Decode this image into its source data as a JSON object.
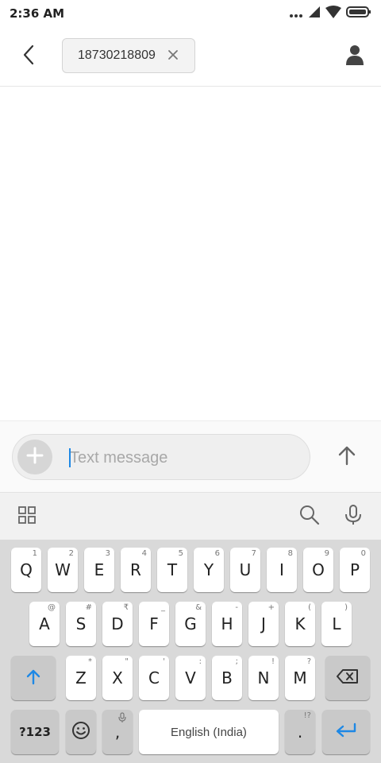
{
  "status_bar": {
    "time": "2:36 AM",
    "icons": [
      "more-dots-icon",
      "signal-icon",
      "wifi-icon",
      "battery-icon"
    ]
  },
  "header": {
    "back_icon": "back-arrow-icon",
    "recipient": "18730218809",
    "remove_icon": "close-icon",
    "contact_icon": "person-icon"
  },
  "composer": {
    "placeholder": "Text message",
    "value": "",
    "attach_icon": "plus-icon",
    "send_icon": "arrow-up-icon"
  },
  "keyboard_toolbar": {
    "icons": [
      "grid-icon",
      "search-icon",
      "microphone-icon"
    ]
  },
  "keyboard": {
    "row1": [
      {
        "label": "Q",
        "hint": "1"
      },
      {
        "label": "W",
        "hint": "2"
      },
      {
        "label": "E",
        "hint": "3"
      },
      {
        "label": "R",
        "hint": "4"
      },
      {
        "label": "T",
        "hint": "5"
      },
      {
        "label": "Y",
        "hint": "6"
      },
      {
        "label": "U",
        "hint": "7"
      },
      {
        "label": "I",
        "hint": "8"
      },
      {
        "label": "O",
        "hint": "9"
      },
      {
        "label": "P",
        "hint": "0"
      }
    ],
    "row2": [
      {
        "label": "A",
        "hint": "@"
      },
      {
        "label": "S",
        "hint": "#"
      },
      {
        "label": "D",
        "hint": "₹"
      },
      {
        "label": "F",
        "hint": "_"
      },
      {
        "label": "G",
        "hint": "&"
      },
      {
        "label": "H",
        "hint": "-"
      },
      {
        "label": "J",
        "hint": "+"
      },
      {
        "label": "K",
        "hint": "("
      },
      {
        "label": "L",
        "hint": ")"
      }
    ],
    "row3": [
      {
        "label": "Z",
        "hint": "*"
      },
      {
        "label": "X",
        "hint": "\""
      },
      {
        "label": "C",
        "hint": "'"
      },
      {
        "label": "V",
        "hint": ":"
      },
      {
        "label": "B",
        "hint": ";"
      },
      {
        "label": "N",
        "hint": "!"
      },
      {
        "label": "M",
        "hint": "?"
      }
    ],
    "shift_icon": "shift-arrow-icon",
    "backspace_icon": "backspace-icon",
    "symbols_label": "?123",
    "emoji_icon": "smiley-icon",
    "comma_label": ",",
    "space_label": "English (India)",
    "period_label": ".",
    "period_hint": "!?",
    "enter_icon": "enter-icon",
    "accent_color": "#1e88e5"
  }
}
